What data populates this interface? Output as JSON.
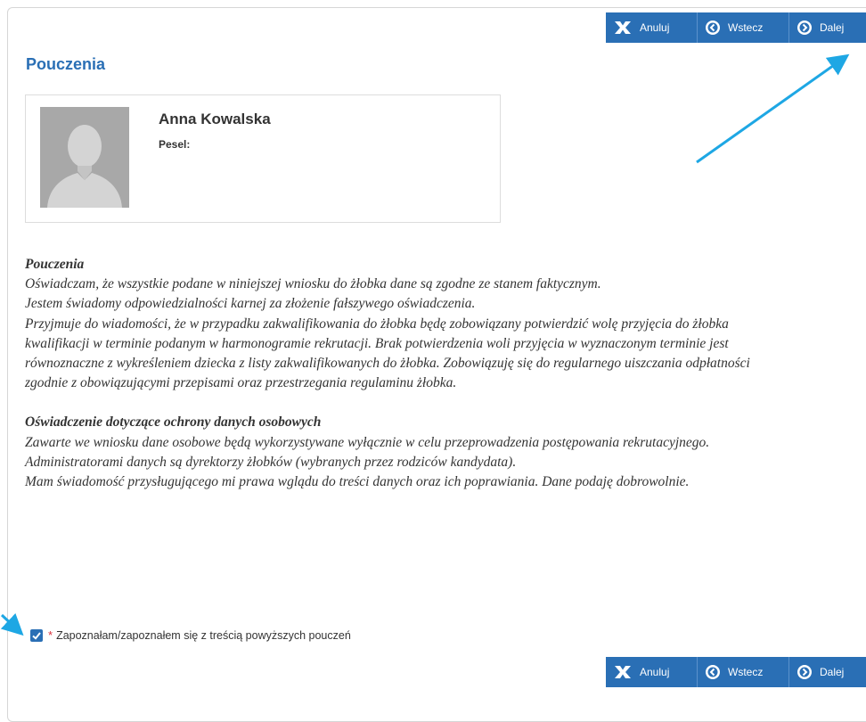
{
  "toolbar": {
    "cancel_label": "Anuluj",
    "back_label": "Wstecz",
    "next_label": "Dalej"
  },
  "page": {
    "title": "Pouczenia"
  },
  "person": {
    "name": "Anna Kowalska",
    "pesel_label": "Pesel:",
    "pesel_value": ""
  },
  "notice": {
    "heading1": "Pouczenia",
    "p1": "Oświadczam, że wszystkie podane w niniejszej wniosku do żłobka dane są zgodne ze stanem faktycznym.",
    "p2": "Jestem świadomy odpowiedzialności karnej za złożenie fałszywego oświadczenia.",
    "p3": "Przyjmuje do wiadomości, że w przypadku zakwalifikowania do żłobka będę zobowiązany potwierdzić wolę przyjęcia do żłobka kwalifikacji w terminie podanym w harmonogramie rekrutacji. Brak potwierdzenia woli przyjęcia w wyznaczonym terminie  jest równoznaczne z wykreśleniem dziecka z listy zakwalifikowanych do żłobka. Zobowiązuję się do regularnego uiszczania odpłatności zgodnie z obowiązującymi przepisami oraz przestrzegania regulaminu żłobka.",
    "heading2": "Oświadczenie dotyczące ochrony danych osobowych",
    "p4": "Zawarte we wniosku dane osobowe będą wykorzystywane wyłącznie w celu przeprowadzenia postępowania rekrutacyjnego.",
    "p5": "Administratorami danych są dyrektorzy żłobków (wybranych przez rodziców kandydata).",
    "p6": "Mam świadomość przysługującego mi prawa wglądu do treści danych oraz ich poprawiania. Dane podaję dobrowolnie."
  },
  "agreement": {
    "required_mark": "*",
    "label": "Zapoznałam/zapoznałem się z treścią powyższych pouczeń",
    "checked": true
  },
  "icons": {
    "cancel": "close-x-icon",
    "back": "circle-arrow-left-icon",
    "next": "circle-arrow-right-icon",
    "avatar": "user-silhouette-icon"
  },
  "colors": {
    "accent": "#2a6fb5",
    "required": "#d9303b",
    "annotation_arrow": "#1ea7e4"
  }
}
